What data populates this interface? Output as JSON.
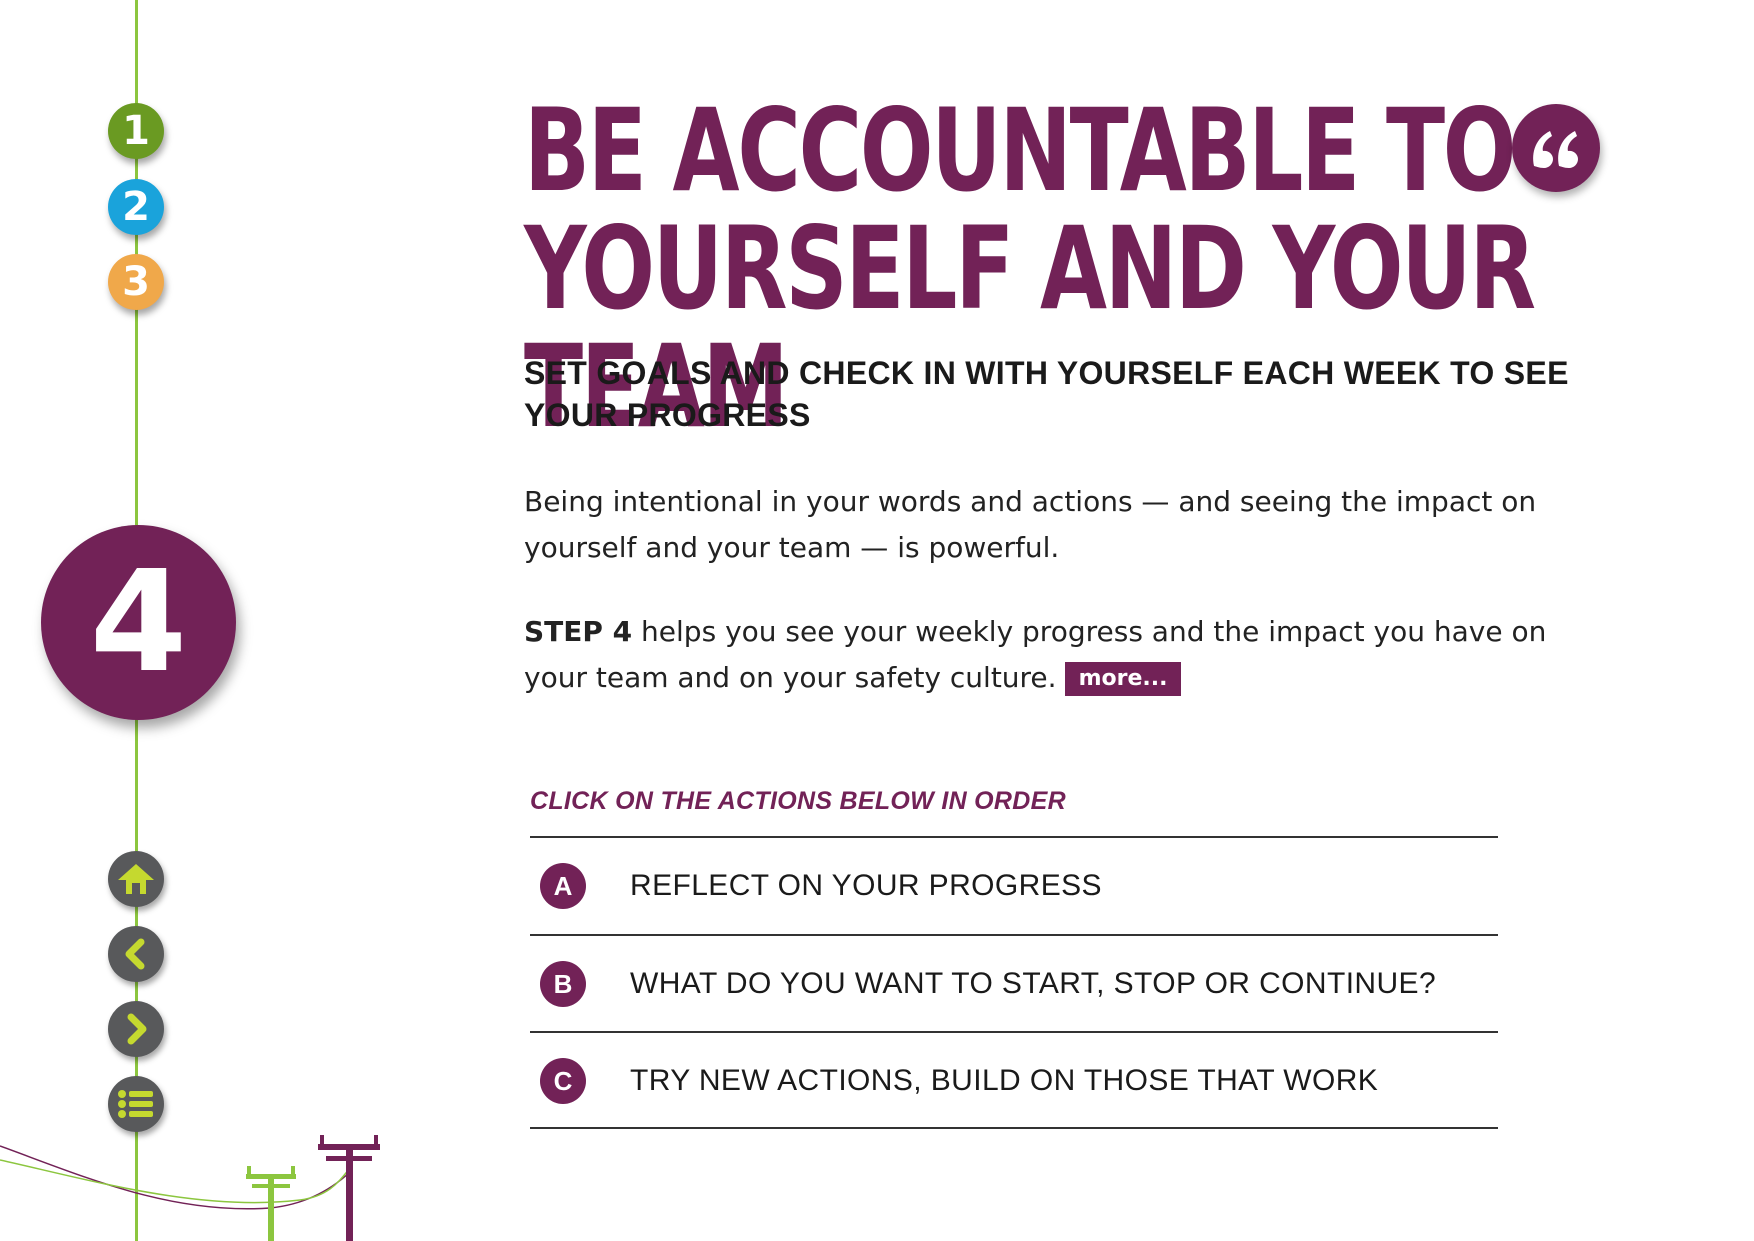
{
  "colors": {
    "brand_purple": "#722257",
    "line_green": "#8cc63f",
    "step1": "#6a9a22",
    "step2": "#1aa3db",
    "step3": "#f0a84a",
    "nav_gray": "#58595b",
    "nav_icon": "#c5d92f"
  },
  "steps": [
    {
      "label": "1",
      "color": "#6a9a22"
    },
    {
      "label": "2",
      "color": "#1aa3db"
    },
    {
      "label": "3",
      "color": "#f0a84a"
    }
  ],
  "current_step": {
    "label": "4"
  },
  "navigation": {
    "home_icon": "home-icon",
    "back_icon": "chevron-left-icon",
    "forward_icon": "chevron-right-icon",
    "menu_icon": "list-icon"
  },
  "header": {
    "title_line1": "BE ACCOUNTABLE TO",
    "title_line2": "YOURSELF AND YOUR TEAM",
    "quote_icon": "quote-icon"
  },
  "subtitle": "SET GOALS AND CHECK IN WITH YOURSELF EACH WEEK TO SEE YOUR PROGRESS",
  "body": {
    "paragraph1": "Being intentional in your words and actions — and seeing the impact on yourself and your team — is powerful.",
    "paragraph2_bold": "STEP 4",
    "paragraph2_rest": " helps you see your weekly progress and the impact you have on your team and on your safety culture.",
    "more_label": "more..."
  },
  "actions": {
    "instruction": "CLICK ON THE ACTIONS BELOW IN ORDER",
    "items": [
      {
        "letter": "A",
        "label": "REFLECT ON YOUR PROGRESS"
      },
      {
        "letter": "B",
        "label": "WHAT DO YOU WANT TO START, STOP OR CONTINUE?"
      },
      {
        "letter": "C",
        "label": "TRY NEW ACTIONS, BUILD ON THOSE THAT WORK"
      }
    ]
  }
}
